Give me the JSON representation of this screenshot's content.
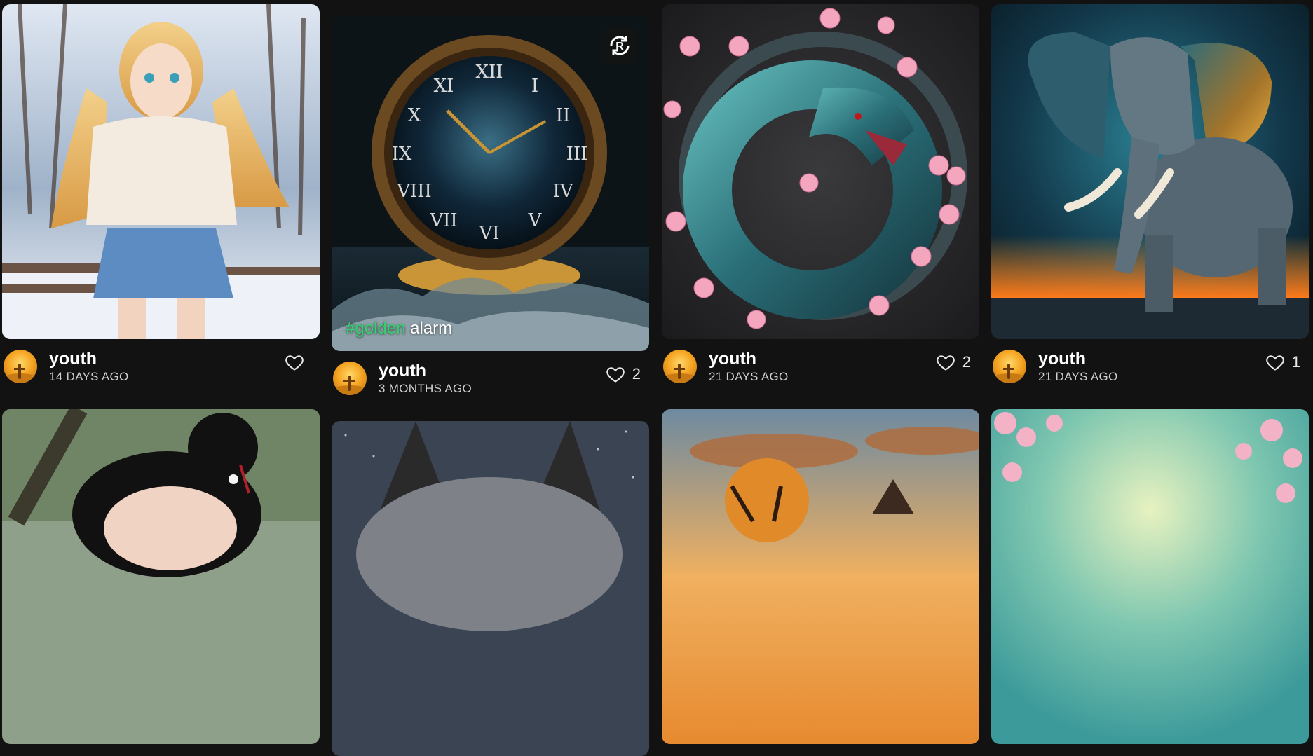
{
  "posts": [
    {
      "user": "youth",
      "time": "14 DAYS AGO",
      "likes": "",
      "image": "anime girl in sweater in snowy park"
    },
    {
      "user": "youth",
      "time": "3 MONTHS AGO",
      "likes": "2",
      "image": "golden clock in ocean waves",
      "caption_tag": "#golden",
      "caption_text": " alarm",
      "badge": "R"
    },
    {
      "user": "youth",
      "time": "21 DAYS AGO",
      "likes": "2",
      "image": "coiled dragon with cherry blossoms"
    },
    {
      "user": "youth",
      "time": "21 DAYS AGO",
      "likes": "1",
      "image": "elephant with glowing ears"
    }
  ],
  "colors": {
    "accent_tag": "#33d06d",
    "background": "#121212"
  }
}
